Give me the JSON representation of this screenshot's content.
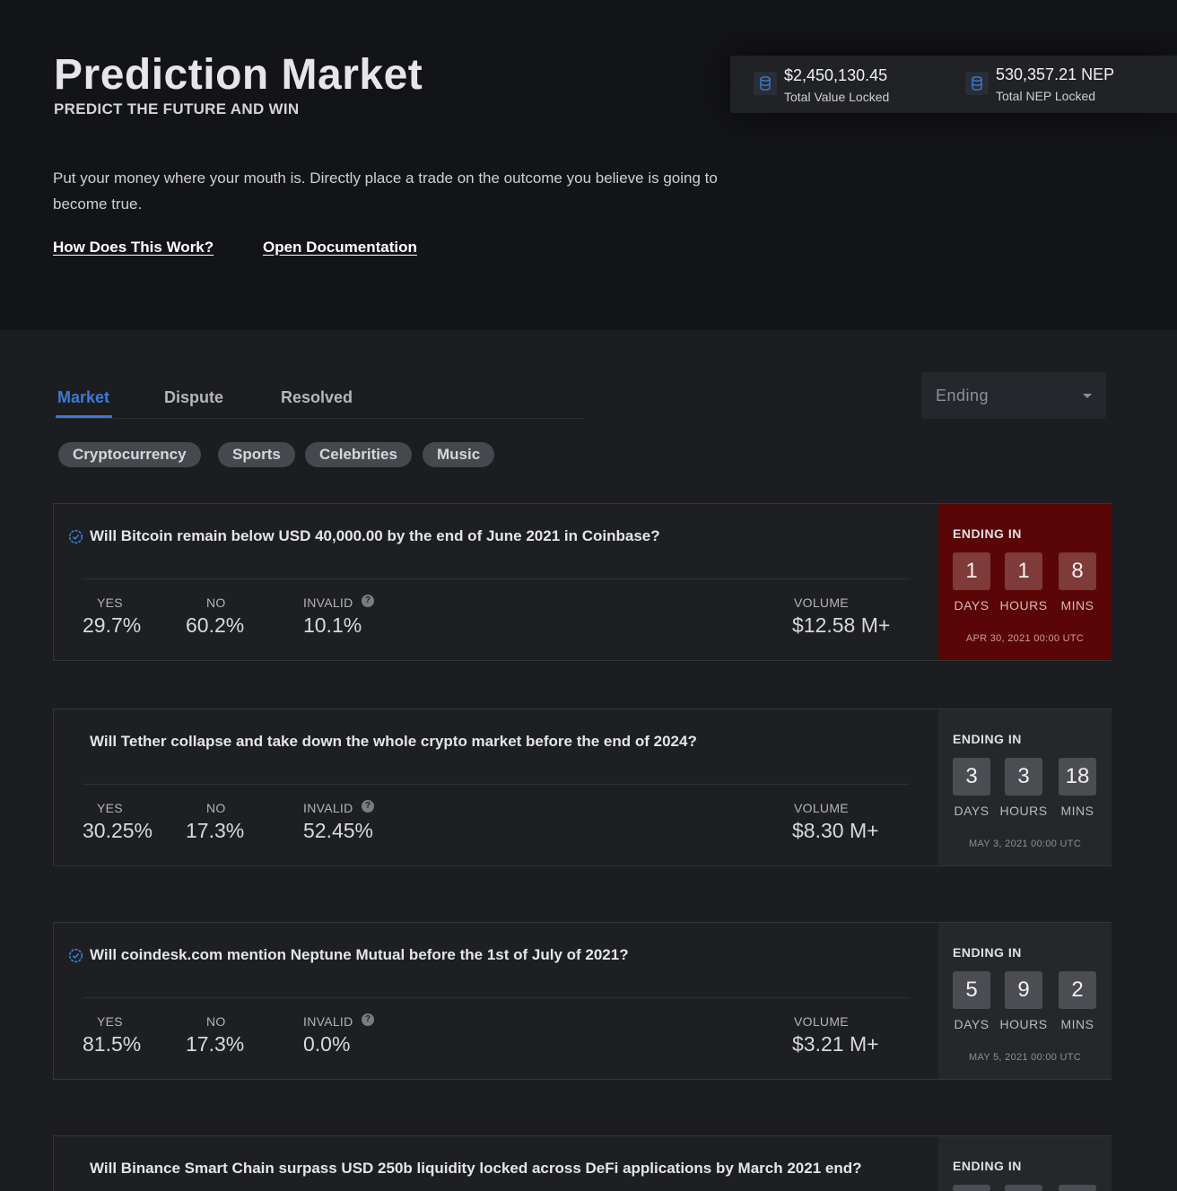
{
  "header": {
    "title": "Prediction Market",
    "subtitle": "PREDICT THE FUTURE AND WIN",
    "description": "Put your money where your mouth is. Directly place a trade on the outcome you believe is going to become true.",
    "links": [
      "How Does This Work?",
      "Open Documentation"
    ]
  },
  "stats": [
    {
      "value": "$2,450,130.45",
      "label": "Total Value Locked",
      "icon": "database-icon"
    },
    {
      "value": "530,357.21 NEP",
      "label": "Total NEP Locked",
      "icon": "database-icon"
    }
  ],
  "tabs": {
    "items": [
      "Market",
      "Dispute",
      "Resolved"
    ],
    "active": "Market"
  },
  "sort": {
    "value": "Ending"
  },
  "categories": [
    "Cryptocurrency",
    "Sports",
    "Celebrities",
    "Music"
  ],
  "labels": {
    "yes": "YES",
    "no": "NO",
    "invalid": "INVALID",
    "volume": "VOLUME",
    "ending_in": "ENDING IN",
    "days": "DAYS",
    "hours": "HOURS",
    "mins": "MINS",
    "help": "?"
  },
  "markets": [
    {
      "question": "Will Bitcoin remain below USD 40,000.00 by the end of June 2021 in Coinbase?",
      "verified": true,
      "yes": "29.7%",
      "no": "60.2%",
      "invalid": "10.1%",
      "volume": "$12.58 M+",
      "days": "1",
      "hours": "1",
      "mins": "8",
      "end_date": "APR 30, 2021 00:00 UTC",
      "urgent": true,
      "colors": {
        "timer_bg": "#5a0606"
      }
    },
    {
      "question": "Will Tether collapse and take down the whole crypto market before the end of 2024?",
      "verified": false,
      "yes": "30.25%",
      "no": "17.3%",
      "invalid": "52.45%",
      "volume": "$8.30 M+",
      "days": "3",
      "hours": "3",
      "mins": "18",
      "end_date": "MAY 3, 2021 00:00 UTC",
      "urgent": false
    },
    {
      "question": "Will coindesk.com mention Neptune Mutual before the 1st of July of 2021?",
      "verified": true,
      "yes": "81.5%",
      "no": "17.3%",
      "invalid": "0.0%",
      "volume": "$3.21 M+",
      "days": "5",
      "hours": "9",
      "mins": "2",
      "end_date": "MAY 5, 2021 00:00 UTC",
      "urgent": false
    },
    {
      "question": "Will Binance Smart Chain surpass USD 250b liquidity locked across DeFi applications by March 2021 end?",
      "verified": false
    }
  ],
  "colors": {
    "accent": "#3a7bd5",
    "background": "#1c1d21",
    "hero_background": "#131418"
  }
}
